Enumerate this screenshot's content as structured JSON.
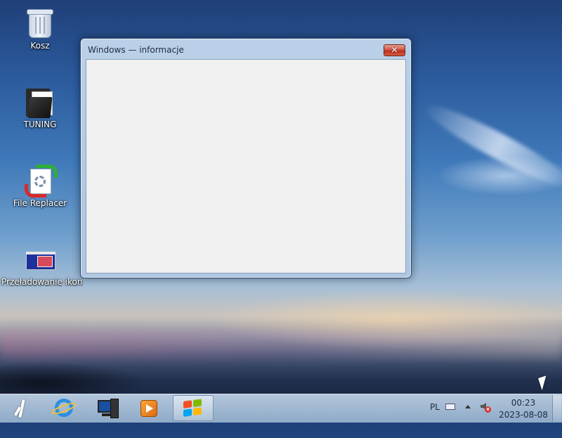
{
  "desktop": {
    "icons": [
      {
        "label": "Kosz",
        "icon": "recycle-bin-icon"
      },
      {
        "label": "TUNING",
        "icon": "folder-icon"
      },
      {
        "label": "File Replacer",
        "icon": "file-replacer-icon"
      },
      {
        "label": "Przeładowanie ikon",
        "icon": "reload-icons-icon"
      }
    ]
  },
  "dialog": {
    "title": "Windows — informacje",
    "close_label": "✕"
  },
  "taskbar": {
    "pinned": [
      {
        "name": "start",
        "icon": "start-icon"
      },
      {
        "name": "internet-explorer",
        "icon": "internet-explorer-icon"
      },
      {
        "name": "computer",
        "icon": "computer-icon"
      },
      {
        "name": "windows-media-player",
        "icon": "media-player-icon"
      },
      {
        "name": "winver",
        "icon": "windows-logo-icon",
        "active": true
      }
    ],
    "tray": {
      "language": "PL",
      "time": "00:23",
      "date": "2023-08-08",
      "speaker_muted_mark": "x"
    }
  },
  "colors": {
    "close_button": "#c94a38",
    "taskbar": "#b4cbe3",
    "dialog_content": "#f0f0f0"
  }
}
